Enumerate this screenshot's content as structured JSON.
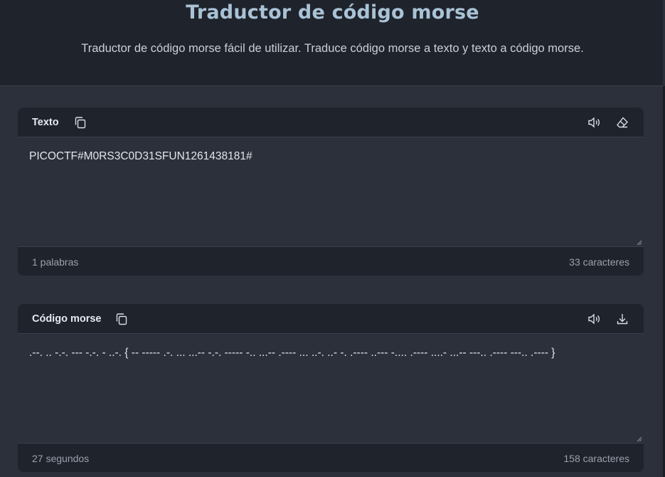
{
  "header": {
    "title": "Traductor de código morse",
    "subtitle": "Traductor de código morse fácil de utilizar. Traduce código morse a texto y texto a código morse."
  },
  "text_panel": {
    "title": "Texto",
    "copy_icon": "copy-icon",
    "speak_icon": "speaker-icon",
    "clear_icon": "eraser-icon",
    "value": "PICOCTF#M0RS3C0D31SFUN1261438181#",
    "word_count": "1 palabras",
    "char_count": "33 caracteres"
  },
  "morse_panel": {
    "title": "Código morse",
    "copy_icon": "copy-icon",
    "speak_icon": "speaker-icon",
    "download_icon": "download-icon",
    "value": ".--. .. -.-. --- -.-. - ..-. { -- ----- .-. ... ...-- -.-. ----- -.. ...-- .---- ... ..-. ..- -. .---- ..--- -.... .---- ....- ...-- ---.. .---- ---.. .---- }",
    "duration": "27 segundos",
    "char_count": "158 caracteres"
  },
  "colors": {
    "background": "#2b303a",
    "panel": "#1f232b",
    "title_accent": "#a9c2d6"
  }
}
